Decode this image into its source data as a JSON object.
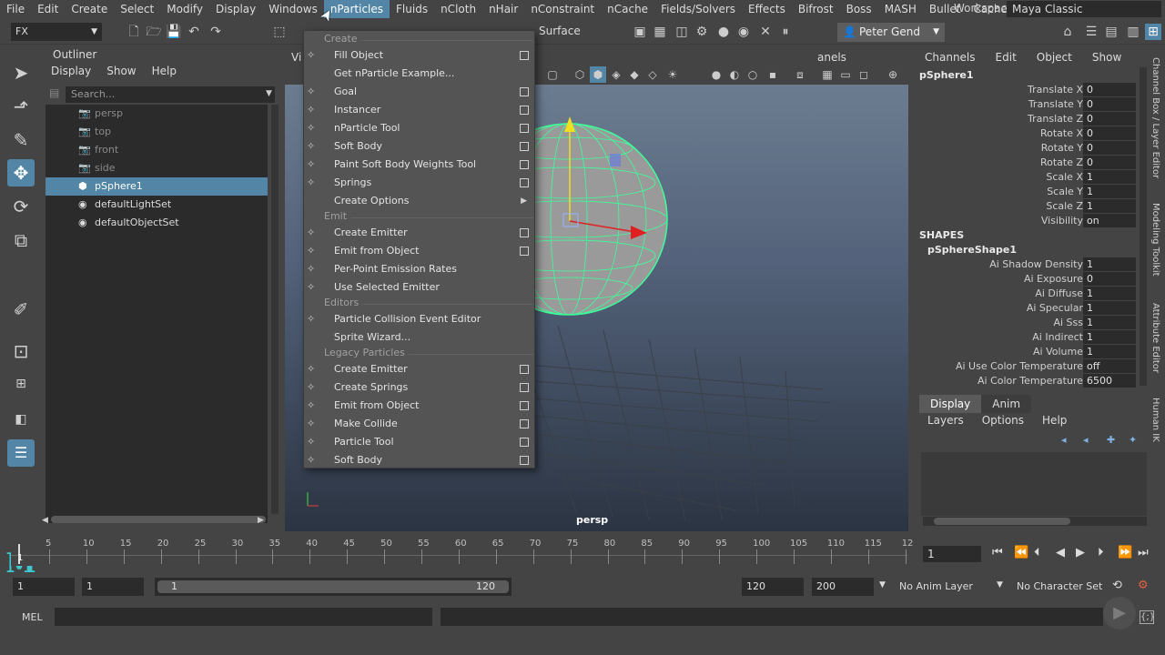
{
  "menubar": {
    "items": [
      "File",
      "Edit",
      "Create",
      "Select",
      "Modify",
      "Display",
      "Windows",
      "nParticles",
      "Fluids",
      "nCloth",
      "nHair",
      "nConstraint",
      "nCache",
      "Fields/Solvers",
      "Effects",
      "Bifrost",
      "Boss",
      "MASH",
      "Bullet",
      "Cache"
    ],
    "active_index": 7,
    "more": "»",
    "workspace_label": "Workspace :",
    "workspace_value": "Maya Classic"
  },
  "toolbar": {
    "menuset": "FX",
    "surface_label": "Surface",
    "user_name": "Peter Gend"
  },
  "outliner": {
    "title": "Outliner",
    "menu": [
      "Display",
      "Show",
      "Help"
    ],
    "search_placeholder": "Search...",
    "items": [
      {
        "label": "persp",
        "icon": "camera-icon",
        "dim": true,
        "selected": false
      },
      {
        "label": "top",
        "icon": "camera-icon",
        "dim": true,
        "selected": false
      },
      {
        "label": "front",
        "icon": "camera-icon",
        "dim": true,
        "selected": false
      },
      {
        "label": "side",
        "icon": "camera-icon",
        "dim": true,
        "selected": false
      },
      {
        "label": "pSphere1",
        "icon": "mesh-icon",
        "dim": false,
        "selected": true
      },
      {
        "label": "defaultLightSet",
        "icon": "set-icon",
        "dim": false,
        "selected": false
      },
      {
        "label": "defaultObjectSet",
        "icon": "set-icon",
        "dim": false,
        "selected": false
      }
    ]
  },
  "viewport": {
    "menu_partial_left": "Vi",
    "menu_panels": "anels",
    "camera_label": "persp"
  },
  "dropdown": {
    "sections": [
      {
        "title": "Create",
        "items": [
          {
            "label": "Fill Object",
            "option": true,
            "submenu": false
          },
          {
            "label": "Get nParticle Example...",
            "option": false,
            "submenu": false
          },
          {
            "label": "Goal",
            "option": true,
            "submenu": false
          },
          {
            "label": "Instancer",
            "option": true,
            "submenu": false
          },
          {
            "label": "nParticle Tool",
            "option": true,
            "submenu": false
          },
          {
            "label": "Soft Body",
            "option": true,
            "submenu": false
          },
          {
            "label": "Paint Soft Body Weights Tool",
            "option": true,
            "submenu": false
          },
          {
            "label": "Springs",
            "option": true,
            "submenu": false
          },
          {
            "label": "Create Options",
            "option": false,
            "submenu": true
          }
        ]
      },
      {
        "title": "Emit",
        "items": [
          {
            "label": "Create Emitter",
            "option": true,
            "submenu": false
          },
          {
            "label": "Emit from Object",
            "option": true,
            "submenu": false
          },
          {
            "label": "Per-Point Emission Rates",
            "option": false,
            "submenu": false
          },
          {
            "label": "Use Selected Emitter",
            "option": false,
            "submenu": false
          }
        ]
      },
      {
        "title": "Editors",
        "items": [
          {
            "label": "Particle Collision Event Editor",
            "option": false,
            "submenu": false
          },
          {
            "label": "Sprite Wizard...",
            "option": false,
            "submenu": false
          }
        ]
      },
      {
        "title": "Legacy Particles",
        "items": [
          {
            "label": "Create Emitter",
            "option": true,
            "submenu": false
          },
          {
            "label": "Create Springs",
            "option": true,
            "submenu": false
          },
          {
            "label": "Emit from Object",
            "option": true,
            "submenu": false
          },
          {
            "label": "Make Collide",
            "option": true,
            "submenu": false
          },
          {
            "label": "Particle Tool",
            "option": true,
            "submenu": false
          },
          {
            "label": "Soft Body",
            "option": true,
            "submenu": false
          }
        ]
      }
    ]
  },
  "channelbox": {
    "menu": [
      "Channels",
      "Edit",
      "Object",
      "Show"
    ],
    "node": "pSphere1",
    "transform": [
      {
        "label": "Translate X",
        "value": "0"
      },
      {
        "label": "Translate Y",
        "value": "0"
      },
      {
        "label": "Translate Z",
        "value": "0"
      },
      {
        "label": "Rotate X",
        "value": "0"
      },
      {
        "label": "Rotate Y",
        "value": "0"
      },
      {
        "label": "Rotate Z",
        "value": "0"
      },
      {
        "label": "Scale X",
        "value": "1"
      },
      {
        "label": "Scale Y",
        "value": "1"
      },
      {
        "label": "Scale Z",
        "value": "1"
      },
      {
        "label": "Visibility",
        "value": "on"
      }
    ],
    "shapes_label": "SHAPES",
    "shape_node": "pSphereShape1",
    "shape_attrs": [
      {
        "label": "Ai Shadow Density",
        "value": "1"
      },
      {
        "label": "Ai Exposure",
        "value": "0"
      },
      {
        "label": "Ai Diffuse",
        "value": "1"
      },
      {
        "label": "Ai Specular",
        "value": "1"
      },
      {
        "label": "Ai Sss",
        "value": "1"
      },
      {
        "label": "Ai Indirect",
        "value": "1"
      },
      {
        "label": "Ai Volume",
        "value": "1"
      },
      {
        "label": "Ai Use Color Temperature",
        "value": "off"
      },
      {
        "label": "Ai Color Temperature",
        "value": "6500"
      }
    ],
    "side_tabs": [
      "Channel Box / Layer Editor",
      "Modeling Toolkit",
      "Attribute Editor",
      "Human IK"
    ]
  },
  "layer_editor": {
    "tabs": [
      "Display",
      "Anim"
    ],
    "menu": [
      "Layers",
      "Options",
      "Help"
    ]
  },
  "timeline": {
    "ticks": [
      "5",
      "10",
      "15",
      "20",
      "25",
      "30",
      "35",
      "40",
      "45",
      "50",
      "55",
      "60",
      "65",
      "70",
      "75",
      "80",
      "85",
      "90",
      "95",
      "100",
      "105",
      "110",
      "115",
      "12"
    ],
    "start_mark": "1",
    "current_frame": "1"
  },
  "range": {
    "start_field": "1",
    "playback_start": "1",
    "slider_start": "1",
    "slider_end": "120",
    "playback_end": "120",
    "end_field": "200",
    "anim_layer": "No Anim Layer",
    "character_set": "No Character Set"
  },
  "command": {
    "label": "MEL"
  }
}
